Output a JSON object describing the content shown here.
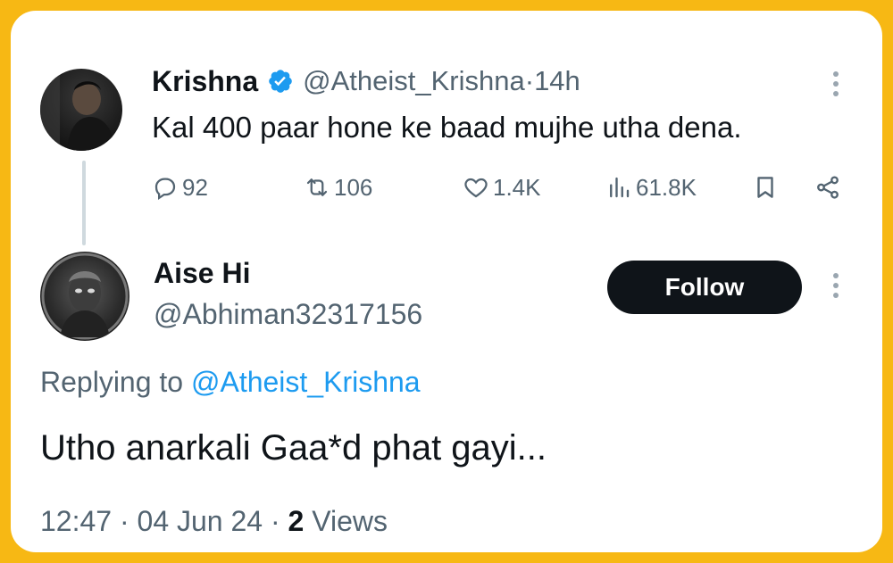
{
  "parent_tweet": {
    "author_name": "Krishna",
    "handle": "@Atheist_Krishna",
    "separator": " · ",
    "time": "14h",
    "text": "Kal 400 paar hone ke baad mujhe utha dena.",
    "verified": true,
    "avatar_icon": "user-avatar-photo",
    "stats": {
      "replies": "92",
      "reposts": "106",
      "likes": "1.4K",
      "views": "61.8K"
    }
  },
  "reply_tweet": {
    "author_name": "Aise Hi",
    "handle": "@Abhiman32317156",
    "follow_label": "Follow",
    "replying_prefix": "Replying to ",
    "replying_to": "@Atheist_Krishna",
    "text": "Utho anarkali Gaa*d phat gayi...",
    "time": "12:47",
    "date": "04 Jun 24",
    "views_count": "2",
    "views_label": "Views"
  },
  "colors": {
    "frame": "#f7b814",
    "accent": "#1d9bf0",
    "text": "#0f1419",
    "muted": "#536471",
    "button": "#0f1419"
  }
}
